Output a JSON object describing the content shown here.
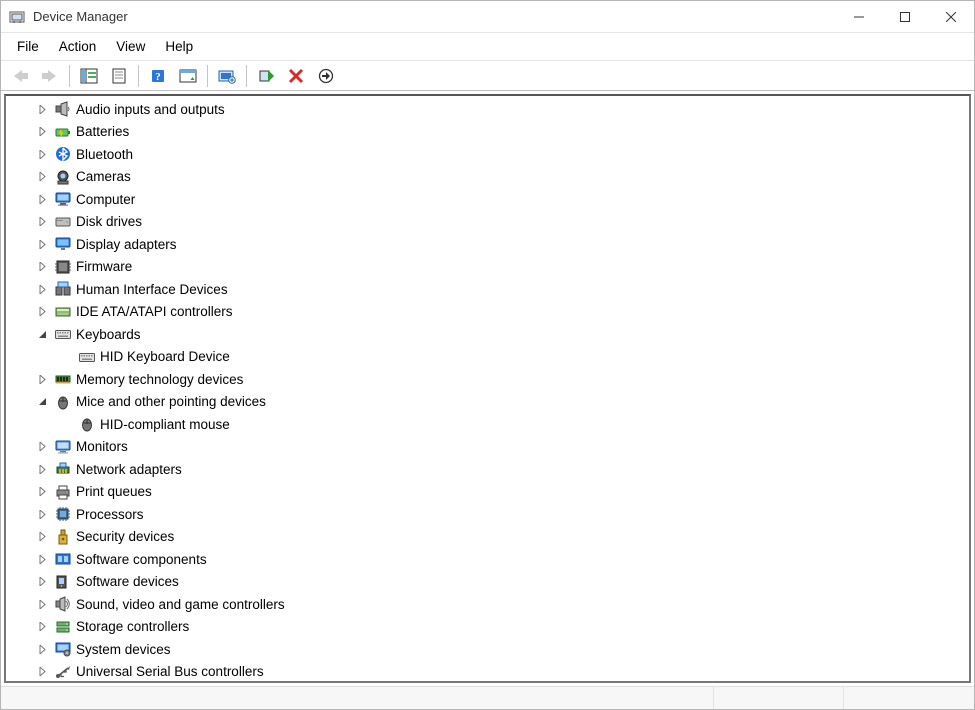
{
  "titlebar": {
    "title": "Device Manager"
  },
  "menubar": {
    "items": [
      "File",
      "Action",
      "View",
      "Help"
    ]
  },
  "toolbar": {
    "buttons": [
      {
        "name": "back-button",
        "disabled": true
      },
      {
        "name": "forward-button",
        "disabled": true
      },
      {
        "name": "sep"
      },
      {
        "name": "show-hide-console-tree-button",
        "disabled": false
      },
      {
        "name": "properties-button",
        "disabled": false
      },
      {
        "name": "sep"
      },
      {
        "name": "help-button",
        "disabled": false
      },
      {
        "name": "action-menu-button",
        "disabled": false
      },
      {
        "name": "sep"
      },
      {
        "name": "update-driver-button",
        "disabled": false
      },
      {
        "name": "sep"
      },
      {
        "name": "enable-device-button",
        "disabled": false
      },
      {
        "name": "uninstall-device-button",
        "disabled": false
      },
      {
        "name": "scan-for-hardware-button",
        "disabled": false
      }
    ]
  },
  "tree": [
    {
      "label": "Audio inputs and outputs",
      "icon": "speaker-icon",
      "state": "collapsed",
      "indent": 1
    },
    {
      "label": "Batteries",
      "icon": "battery-icon",
      "state": "collapsed",
      "indent": 1
    },
    {
      "label": "Bluetooth",
      "icon": "bluetooth-icon",
      "state": "collapsed",
      "indent": 1
    },
    {
      "label": "Cameras",
      "icon": "camera-icon",
      "state": "collapsed",
      "indent": 1
    },
    {
      "label": "Computer",
      "icon": "computer-icon",
      "state": "collapsed",
      "indent": 1
    },
    {
      "label": "Disk drives",
      "icon": "disk-icon",
      "state": "collapsed",
      "indent": 1
    },
    {
      "label": "Display adapters",
      "icon": "display-icon",
      "state": "collapsed",
      "indent": 1
    },
    {
      "label": "Firmware",
      "icon": "firmware-icon",
      "state": "collapsed",
      "indent": 1
    },
    {
      "label": "Human Interface Devices",
      "icon": "hid-icon",
      "state": "collapsed",
      "indent": 1
    },
    {
      "label": "IDE ATA/ATAPI controllers",
      "icon": "ide-icon",
      "state": "collapsed",
      "indent": 1
    },
    {
      "label": "Keyboards",
      "icon": "keyboard-icon",
      "state": "expanded",
      "indent": 1
    },
    {
      "label": "HID Keyboard Device",
      "icon": "keyboard-icon",
      "state": "leaf",
      "indent": 2
    },
    {
      "label": "Memory technology devices",
      "icon": "memory-icon",
      "state": "collapsed",
      "indent": 1
    },
    {
      "label": "Mice and other pointing devices",
      "icon": "mouse-icon",
      "state": "expanded",
      "indent": 1
    },
    {
      "label": "HID-compliant mouse",
      "icon": "mouse-icon",
      "state": "leaf",
      "indent": 2
    },
    {
      "label": "Monitors",
      "icon": "monitor-icon",
      "state": "collapsed",
      "indent": 1
    },
    {
      "label": "Network adapters",
      "icon": "network-icon",
      "state": "collapsed",
      "indent": 1
    },
    {
      "label": "Print queues",
      "icon": "printer-icon",
      "state": "collapsed",
      "indent": 1
    },
    {
      "label": "Processors",
      "icon": "processor-icon",
      "state": "collapsed",
      "indent": 1
    },
    {
      "label": "Security devices",
      "icon": "security-icon",
      "state": "collapsed",
      "indent": 1
    },
    {
      "label": "Software components",
      "icon": "software-comp-icon",
      "state": "collapsed",
      "indent": 1
    },
    {
      "label": "Software devices",
      "icon": "software-dev-icon",
      "state": "collapsed",
      "indent": 1
    },
    {
      "label": "Sound, video and game controllers",
      "icon": "sound-icon",
      "state": "collapsed",
      "indent": 1
    },
    {
      "label": "Storage controllers",
      "icon": "storage-icon",
      "state": "collapsed",
      "indent": 1
    },
    {
      "label": "System devices",
      "icon": "system-icon",
      "state": "collapsed",
      "indent": 1
    },
    {
      "label": "Universal Serial Bus controllers",
      "icon": "usb-icon",
      "state": "collapsed",
      "indent": 1
    }
  ]
}
